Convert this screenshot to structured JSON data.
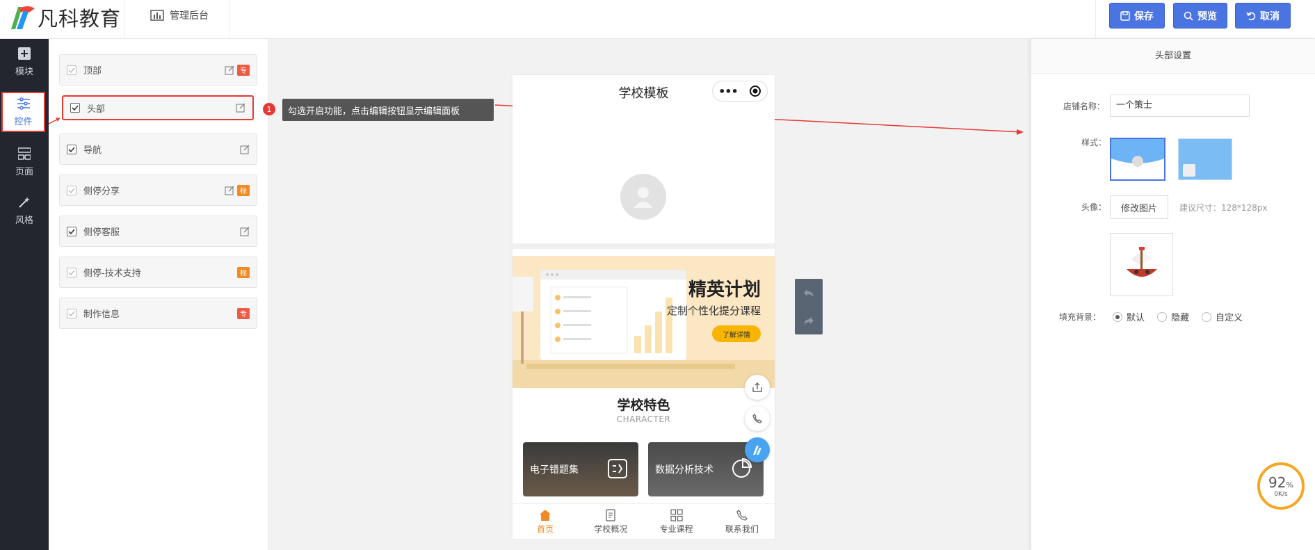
{
  "header": {
    "brand": "凡科教育",
    "admin_label": "管理后台",
    "buttons": {
      "save": "保存",
      "preview": "预览",
      "cancel": "取消"
    }
  },
  "leftnav": [
    {
      "label": "模块",
      "icon": "plus-square-icon"
    },
    {
      "label": "控件",
      "icon": "sliders-icon",
      "active": true
    },
    {
      "label": "页面",
      "icon": "layout-icon"
    },
    {
      "label": "风格",
      "icon": "magic-wand-icon"
    }
  ],
  "controls": [
    {
      "label": "顶部",
      "checked": false,
      "editable": true,
      "tag": "专",
      "tag_color": "#ef5a44"
    },
    {
      "label": "头部",
      "checked": true,
      "editable": true,
      "tag": "",
      "highlighted": true
    },
    {
      "label": "导航",
      "checked": true,
      "editable": true,
      "tag": ""
    },
    {
      "label": "侧停分享",
      "checked": false,
      "editable": true,
      "tag": "标",
      "tag_color": "#f08a24"
    },
    {
      "label": "侧停客服",
      "checked": true,
      "editable": true,
      "tag": ""
    },
    {
      "label": "侧停-技术支持",
      "checked": false,
      "editable": false,
      "tag": "标",
      "tag_color": "#f08a24"
    },
    {
      "label": "制作信息",
      "checked": false,
      "editable": false,
      "tag": "专",
      "tag_color": "#ef5a44"
    }
  ],
  "annotation": {
    "number": "1",
    "text": "勾选开启功能，点击编辑按钮显示编辑面板"
  },
  "phone": {
    "title": "学校模板",
    "banner": {
      "title": "精英计划",
      "subtitle": "定制个性化提分课程",
      "button": "了解详情"
    },
    "section_title": "学校特色",
    "section_subtitle": "CHARACTER",
    "cards": [
      "电子错题集",
      "数据分析技术"
    ],
    "tabs": [
      "首页",
      "学校概况",
      "专业课程",
      "联系我们"
    ]
  },
  "right_panel": {
    "title": "头部设置",
    "shop_name_label": "店铺名称：",
    "shop_name_value": "一个策士",
    "style_label": "样式：",
    "avatar_label": "头像：",
    "change_image": "修改图片",
    "size_hint": "建议尺寸：128*128px",
    "fill_bg_label": "填充背景：",
    "fill_options": [
      "默认",
      "隐藏",
      "自定义"
    ],
    "fill_selected": "默认"
  },
  "speed_widget": {
    "percent": "92",
    "unit": "%",
    "rate": "0K/s"
  },
  "colors": {
    "accent": "#4a74e2",
    "nav_bg": "#23262e",
    "highlight": "#e53935",
    "tag_orange": "#f08a24",
    "tag_red": "#ef5a44"
  }
}
